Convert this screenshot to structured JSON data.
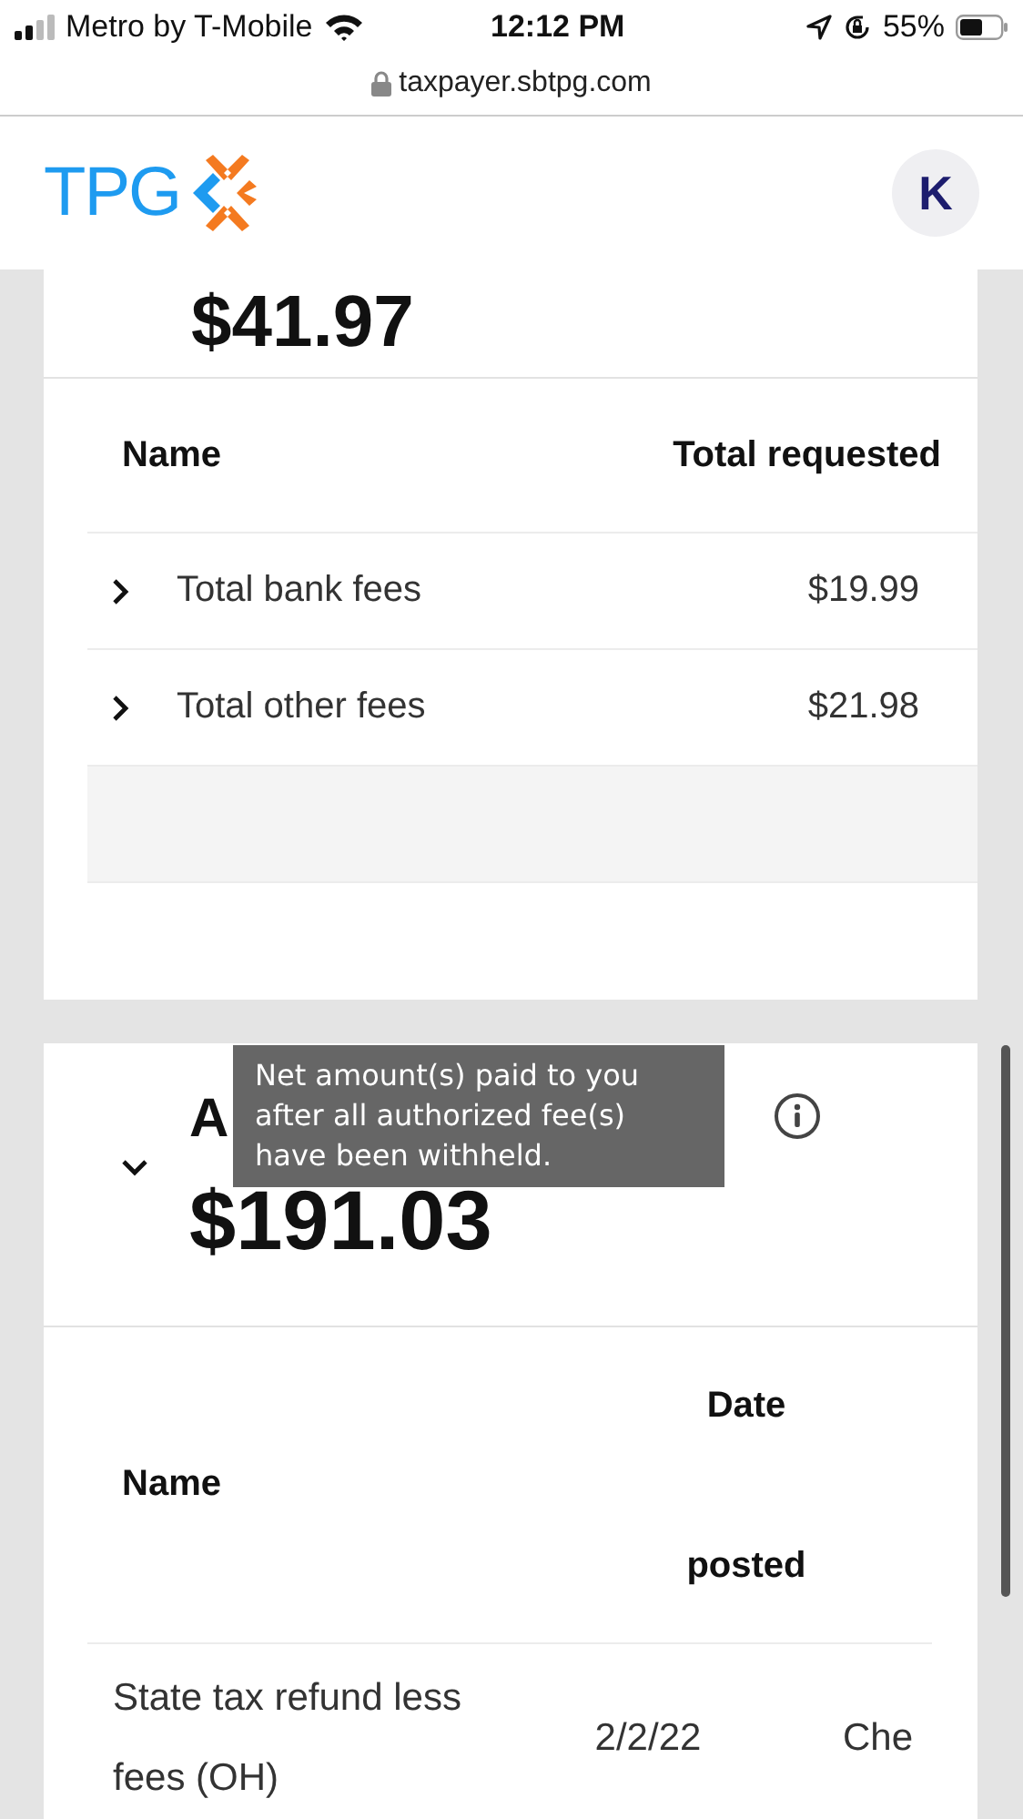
{
  "status_bar": {
    "carrier": "Metro by T-Mobile",
    "time": "12:12 PM",
    "battery": "55%"
  },
  "url_bar": {
    "url": "taxpayer.sbtpg.com"
  },
  "header": {
    "logo": "TPG",
    "avatar": "K"
  },
  "fees_card": {
    "amount": "$41.97",
    "table": {
      "columns": [
        "Name",
        "Total requested"
      ],
      "rows": [
        {
          "name": "Total bank fees",
          "amount": "$19.99",
          "expanded": false
        },
        {
          "name": "Total other fees",
          "amount": "$21.98",
          "expanded": false
        }
      ]
    }
  },
  "payout_card": {
    "heading": "A",
    "expanded": true,
    "amount": "$191.03",
    "tooltip": "Net amount(s) paid to you after all authorized fee(s) have been withheld.",
    "table": {
      "columns": [
        "Name",
        "Date posted"
      ],
      "rows": [
        {
          "name": "State tax refund less fees (OH)",
          "date": "2/2/22",
          "column_3": "Che"
        }
      ]
    }
  }
}
